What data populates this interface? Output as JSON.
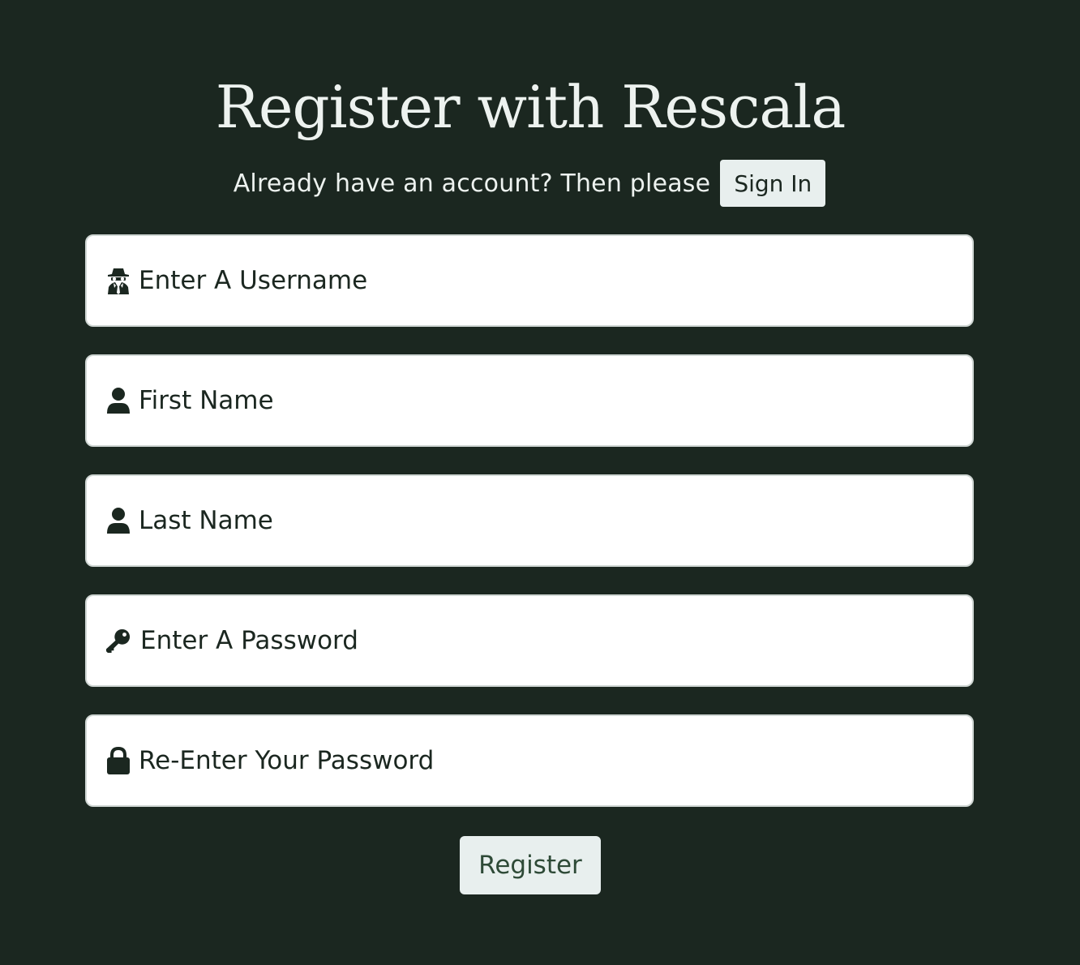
{
  "header": {
    "title": "Register with Rescala",
    "subtitle": "Already have an account? Then please",
    "signin_label": "Sign In"
  },
  "form": {
    "fields": [
      {
        "placeholder": "Enter A Username",
        "icon": "user-secret-icon"
      },
      {
        "placeholder": "First Name",
        "icon": "user-icon"
      },
      {
        "placeholder": "Last Name",
        "icon": "user-icon"
      },
      {
        "placeholder": "Enter A Password",
        "icon": "key-icon"
      },
      {
        "placeholder": "Re-Enter Your Password",
        "icon": "lock-icon"
      }
    ],
    "register_label": "Register"
  },
  "colors": {
    "background": "#1b2720",
    "accent": "#e8efee",
    "text_dark": "#1b2720",
    "button_text": "#2e4a37"
  }
}
